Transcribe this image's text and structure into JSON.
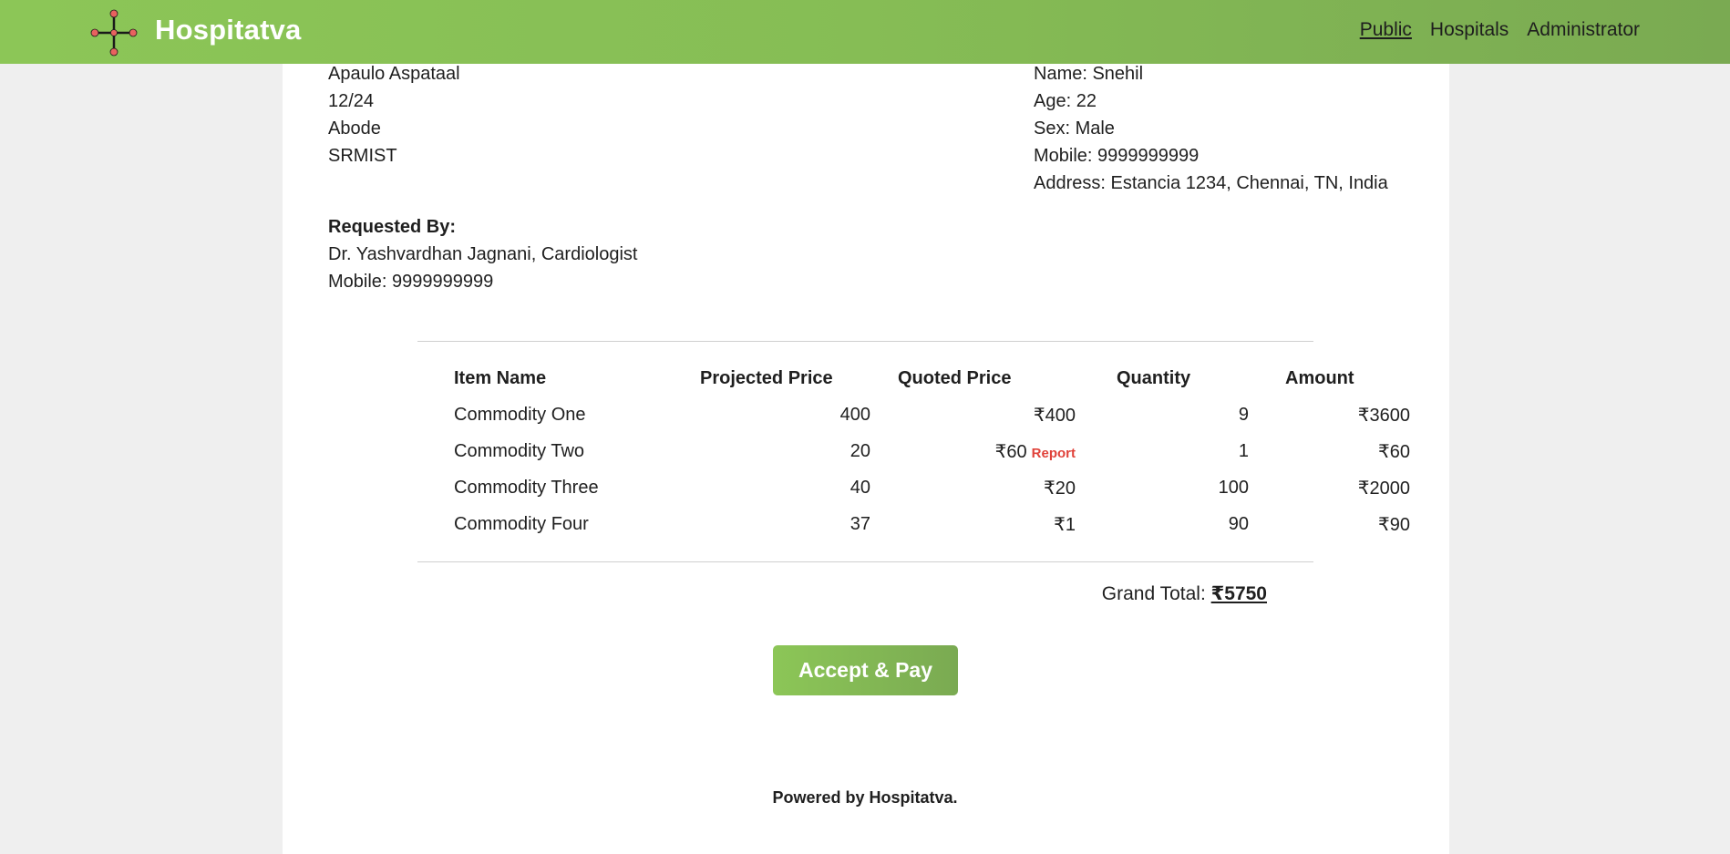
{
  "navbar": {
    "brand": "Hospitatva",
    "logo_icon": "cross-node-logo-icon",
    "links": [
      {
        "label": "Public",
        "active": true
      },
      {
        "label": "Hospitals",
        "active": false
      },
      {
        "label": "Administrator",
        "active": false
      }
    ]
  },
  "hospital": {
    "name": "Apaulo Aspataal",
    "line2": "12/24",
    "line3": "Abode",
    "line4": "SRMIST"
  },
  "patient": {
    "name": "Name: Snehil",
    "age": "Age: 22",
    "sex": "Sex: Male",
    "mobile": "Mobile: 9999999999",
    "address": "Address: Estancia 1234, Chennai, TN, India"
  },
  "requester": {
    "label": "Requested By:",
    "doctor": "Dr. Yashvardhan Jagnani, Cardiologist",
    "mobile": "Mobile: 9999999999"
  },
  "table": {
    "headers": [
      "Item Name",
      "Projected Price",
      "Quoted Price",
      "Quantity",
      "Amount"
    ],
    "rows": [
      {
        "item": "Commodity One",
        "projected": "400",
        "quoted": "₹400",
        "quantity": "9",
        "amount": "₹3600"
      },
      {
        "item": "Commodity Two",
        "projected": "20",
        "quoted": "₹60",
        "quantity": "1",
        "amount": "₹60"
      },
      {
        "item": "Commodity Three",
        "projected": "40",
        "quoted": "₹20",
        "quantity": "100",
        "amount": "₹2000"
      },
      {
        "item": "Commodity Four",
        "projected": "37",
        "quoted": "₹1",
        "quantity": "90",
        "amount": "₹90"
      }
    ],
    "report_label": "Report"
  },
  "total": {
    "label": "Grand Total: ",
    "value": "₹5750"
  },
  "actions": {
    "pay_label": "Accept & Pay"
  },
  "footer": {
    "text": "Powered by Hospitatva."
  },
  "colors": {
    "navbar_start": "#8cc657",
    "navbar_end": "#7aaa52",
    "report": "#e0423a",
    "logo_dot": "#e8625f"
  }
}
